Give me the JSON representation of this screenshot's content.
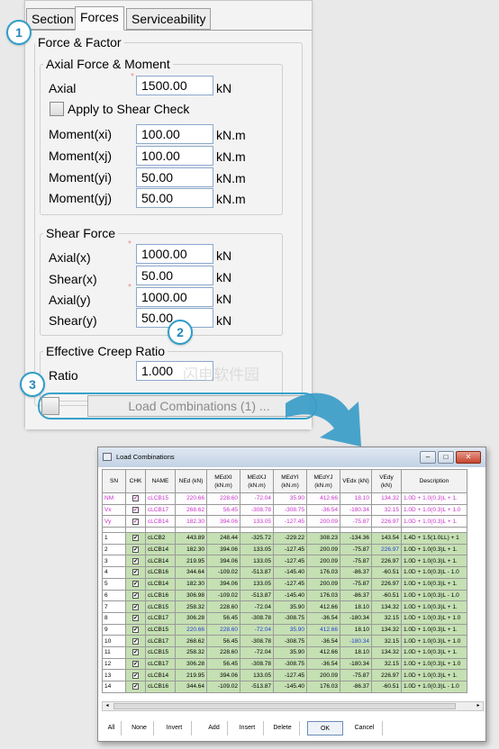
{
  "tabs": [
    "Section",
    "Forces",
    "Serviceability"
  ],
  "force_factor": {
    "title": "Force & Factor",
    "axial_group": {
      "title": "Axial Force & Moment",
      "axial_label": "Axial",
      "axial_value": "1500.00",
      "axial_unit": "kN",
      "apply_label": "Apply to Shear Check",
      "moments": [
        {
          "label": "Moment(xi)",
          "value": "100.00",
          "unit": "kN.m"
        },
        {
          "label": "Moment(xj)",
          "value": "100.00",
          "unit": "kN.m"
        },
        {
          "label": "Moment(yi)",
          "value": "50.00",
          "unit": "kN.m"
        },
        {
          "label": "Moment(yj)",
          "value": "50.00",
          "unit": "kN.m"
        }
      ]
    },
    "shear_group": {
      "title": "Shear Force",
      "rows": [
        {
          "label": "Axial(x)",
          "value": "1000.00",
          "unit": "kN"
        },
        {
          "label": "Shear(x)",
          "value": "50.00",
          "unit": "kN"
        },
        {
          "label": "Axial(y)",
          "value": "1000.00",
          "unit": "kN"
        },
        {
          "label": "Shear(y)",
          "value": "50.00",
          "unit": "kN"
        }
      ]
    },
    "creep_group": {
      "title": "Effective Creep Ratio",
      "ratio_label": "Ratio",
      "ratio_value": "1.000"
    }
  },
  "load_combinations_button": "Load Combinations (1) ...",
  "badges": [
    "1",
    "2",
    "3"
  ],
  "dialog": {
    "title": "Load Combinations",
    "columns": [
      "SN",
      "CHK",
      "NAME",
      "NEd (kN)",
      "MEdXI (kN.m)",
      "MEdXJ (kN.m)",
      "MEdYI (kN.m)",
      "MEdYJ (kN.m)",
      "VEdx (kN)",
      "VEdy (kN)",
      "Description"
    ],
    "env_rows": [
      [
        "NM",
        "✔",
        "cLCB15",
        "220.66",
        "228.60",
        "-72.04",
        "35.90",
        "412.66",
        "18.10",
        "134.32",
        "1.0D + 1.0(0.3)L + 1."
      ],
      [
        "Vx",
        "✔",
        "cLCB17",
        "268.62",
        "56.45",
        "-308.78",
        "-308.75",
        "-36.54",
        "-180.34",
        "32.15",
        "1.0D + 1.0(0.3)L + 1.0"
      ],
      [
        "Vy",
        "✔",
        "cLCB14",
        "182.30",
        "394.06",
        "133.05",
        "-127.45",
        "200.09",
        "-75.87",
        "226.97",
        "1.0D + 1.0(0.3)L + 1."
      ]
    ],
    "rows": [
      [
        "1",
        "✔",
        "cLCB2",
        "443.89",
        "248.44",
        "-325.72",
        "-229.22",
        "308.23",
        "-134.36",
        "143.54",
        "1.4D + 1.5(1.0LL) + 1"
      ],
      [
        "2",
        "✔",
        "cLCB14",
        "182.30",
        "394.06",
        "133.05",
        "-127.45",
        "200.09",
        "-75.87",
        "226.97",
        "1.0D + 1.0(0.3)L + 1."
      ],
      [
        "3",
        "✔",
        "cLCB14",
        "219.95",
        "394.06",
        "133.05",
        "-127.45",
        "200.09",
        "-75.87",
        "226.97",
        "1.0D + 1.0(0.3)L + 1."
      ],
      [
        "4",
        "✔",
        "cLCB16",
        "344.64",
        "-109.02",
        "-513.87",
        "-145.40",
        "176.03",
        "-86.37",
        "-60.51",
        "1.0D + 1.0(0.3)L - 1.0"
      ],
      [
        "5",
        "✔",
        "cLCB14",
        "182.30",
        "394.06",
        "133.05",
        "-127.45",
        "200.09",
        "-75.87",
        "226.97",
        "1.0D + 1.0(0.3)L + 1."
      ],
      [
        "6",
        "✔",
        "cLCB16",
        "306.98",
        "-109.02",
        "-513.87",
        "-145.40",
        "176.03",
        "-86.37",
        "-60.51",
        "1.0D + 1.0(0.3)L - 1.0"
      ],
      [
        "7",
        "✔",
        "cLCB15",
        "258.32",
        "228.60",
        "-72.04",
        "35.90",
        "412.66",
        "18.10",
        "134.32",
        "1.0D + 1.0(0.3)L + 1."
      ],
      [
        "8",
        "✔",
        "cLCB17",
        "306.28",
        "56.45",
        "-308.78",
        "-308.75",
        "-36.54",
        "-180.34",
        "32.15",
        "1.0D + 1.0(0.3)L + 1.0"
      ],
      [
        "9",
        "✔",
        "cLCB15",
        "220.66",
        "228.60",
        "-72.04",
        "35.90",
        "412.66",
        "18.10",
        "134.32",
        "1.0D + 1.0(0.3)L + 1."
      ],
      [
        "10",
        "✔",
        "cLCB17",
        "268.62",
        "56.45",
        "-308.78",
        "-308.75",
        "-36.54",
        "-180.34",
        "32.15",
        "1.0D + 1.0(0.3)L + 1.0"
      ],
      [
        "11",
        "✔",
        "cLCB15",
        "258.32",
        "228.60",
        "-72.04",
        "35.90",
        "412.66",
        "18.10",
        "134.32",
        "1.0D + 1.0(0.3)L + 1."
      ],
      [
        "12",
        "✔",
        "cLCB17",
        "306.28",
        "56.45",
        "-308.78",
        "-308.75",
        "-36.54",
        "-180.34",
        "32.15",
        "1.0D + 1.0(0.3)L + 1.0"
      ],
      [
        "13",
        "✔",
        "cLCB14",
        "219.95",
        "394.06",
        "133.05",
        "-127.45",
        "200.09",
        "-75.87",
        "226.97",
        "1.0D + 1.0(0.3)L + 1."
      ],
      [
        "14",
        "✔",
        "cLCB16",
        "344.64",
        "-109.02",
        "-513.87",
        "-145.40",
        "176.03",
        "-86.37",
        "-60.51",
        "1.0D + 1.0(0.3)L - 1.0"
      ]
    ],
    "buttons": [
      "All",
      "None",
      "Invert",
      "Add",
      "Insert",
      "Delete",
      "OK",
      "Cancel"
    ]
  },
  "watermark": "闪电软件园",
  "colors": {
    "accent": "#2f9dc9",
    "env_text": "#cc33cc",
    "row_green": "#c5e0b3",
    "highlight_blue": "#2b3fd6"
  }
}
